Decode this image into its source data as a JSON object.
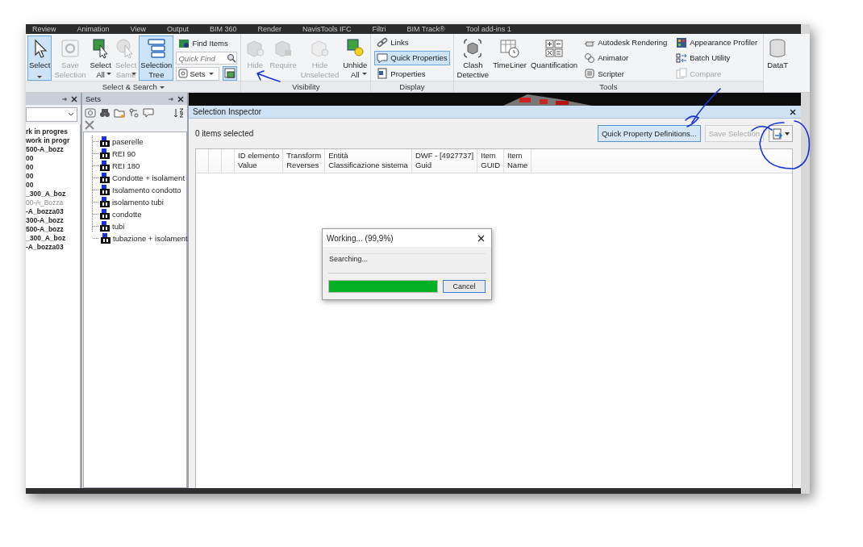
{
  "menu_tabs": [
    "Review",
    "Animation",
    "View",
    "Output",
    "BIM 360",
    "Render",
    "NavisTools IFC",
    "Filtri",
    "BIM Track®",
    "Tool add-ins 1"
  ],
  "ribbon": [
    {
      "title": "Select & Search",
      "menu": true,
      "items": [
        {
          "kind": "large",
          "label": "Select",
          "dropdown": true,
          "active": true,
          "disabled": false
        },
        {
          "kind": "large",
          "label": "Save Selection",
          "dropdown": false,
          "active": false,
          "disabled": true
        },
        {
          "kind": "large",
          "label": "Select All",
          "dropdown": true,
          "active": false,
          "disabled": false
        },
        {
          "kind": "large",
          "label": "Select Same",
          "dropdown": true,
          "active": false,
          "disabled": true
        },
        {
          "kind": "large",
          "label": "Selection Tree",
          "dropdown": false,
          "active": true,
          "disabled": false
        },
        {
          "kind": "search",
          "find_label": "Find Items",
          "placeholder": "Quick Find",
          "sets_label": "Sets",
          "tree_active": true
        }
      ]
    },
    {
      "title": "Visibility",
      "menu": false,
      "items": [
        {
          "kind": "large",
          "label": "Hide",
          "dropdown": false,
          "active": false,
          "disabled": true
        },
        {
          "kind": "large",
          "label": "Require",
          "dropdown": false,
          "active": false,
          "disabled": true
        },
        {
          "kind": "large",
          "label": "Hide Unselected",
          "dropdown": false,
          "active": false,
          "disabled": true
        },
        {
          "kind": "large",
          "label": "Unhide All",
          "dropdown": true,
          "active": false,
          "disabled": false
        }
      ]
    },
    {
      "title": "Display",
      "menu": false,
      "items": [
        {
          "kind": "column",
          "entries": [
            {
              "label": "Links",
              "active": false,
              "disabled": false
            },
            {
              "label": "Quick Properties",
              "active": true,
              "disabled": false
            },
            {
              "label": "Properties",
              "active": false,
              "disabled": false
            }
          ]
        }
      ]
    },
    {
      "title": "Tools",
      "menu": false,
      "items": [
        {
          "kind": "large",
          "label": "Clash Detective",
          "dropdown": false,
          "active": false,
          "disabled": false
        },
        {
          "kind": "large",
          "label": "TimeLiner",
          "dropdown": false,
          "active": false,
          "disabled": false
        },
        {
          "kind": "large",
          "label": "Quantification",
          "dropdown": false,
          "active": false,
          "disabled": false
        },
        {
          "kind": "column",
          "entries": [
            {
              "label": "Autodesk Rendering",
              "active": false,
              "disabled": false
            },
            {
              "label": "Animator",
              "active": false,
              "disabled": false
            },
            {
              "label": "Scripter",
              "active": false,
              "disabled": false
            }
          ]
        },
        {
          "kind": "column",
          "entries": [
            {
              "label": "Appearance Profiler",
              "active": false,
              "disabled": false
            },
            {
              "label": "Batch Utility",
              "active": false,
              "disabled": false
            },
            {
              "label": "Compare",
              "active": false,
              "disabled": true
            }
          ]
        }
      ]
    },
    {
      "items": [
        {
          "kind": "large",
          "label": "DataT",
          "dropdown": false,
          "active": false,
          "disabled": false
        }
      ]
    }
  ],
  "models": {
    "items": [
      {
        "text": "rk in progres",
        "hidden": false
      },
      {
        "text": "work in progr",
        "hidden": false
      },
      {
        "text": "500-A_bozz",
        "hidden": false
      },
      {
        "text": "00",
        "hidden": false
      },
      {
        "text": "00",
        "hidden": false
      },
      {
        "text": "00",
        "hidden": false
      },
      {
        "text": "00",
        "hidden": false
      },
      {
        "text": "_300_A_boz",
        "hidden": false
      },
      {
        "text": "00-A_Bozza",
        "hidden": true
      },
      {
        "text": "-A_bozza03",
        "hidden": false
      },
      {
        "text": "300-A_bozz",
        "hidden": false
      },
      {
        "text": "500-A_bozz",
        "hidden": false
      },
      {
        "text": "_300_A_boz",
        "hidden": false
      },
      {
        "text": "-A_bozza03",
        "hidden": false
      }
    ]
  },
  "sets": {
    "title": "Sets",
    "items": [
      "paserelle",
      "REI 90",
      "REI 180",
      "Condotte + isolament",
      "Isolamento condotto",
      "isolamento tubi",
      "condotte",
      "tubi",
      "tubazione + isolament"
    ]
  },
  "inspector": {
    "title": "Selection Inspector",
    "count": "0 items selected",
    "buttons": [
      {
        "label": "Quick Property Definitions...",
        "active": true,
        "disabled": false
      },
      {
        "label": "Save Selection",
        "active": false,
        "disabled": true
      }
    ],
    "columns": [
      {
        "category": "ID elemento",
        "property": "Value"
      },
      {
        "category": "Transform",
        "property": "Reverses"
      },
      {
        "category": "Entità",
        "property": "Classificazione sistema"
      },
      {
        "category": "DWF - [4927737]",
        "property": "Guid"
      },
      {
        "category": "Item",
        "property": "GUID"
      },
      {
        "category": "Item",
        "property": "Name"
      }
    ]
  },
  "dialog": {
    "title": "Working... (99,9%)",
    "status": "Searching...",
    "level": 0.999,
    "button": "Cancel"
  }
}
